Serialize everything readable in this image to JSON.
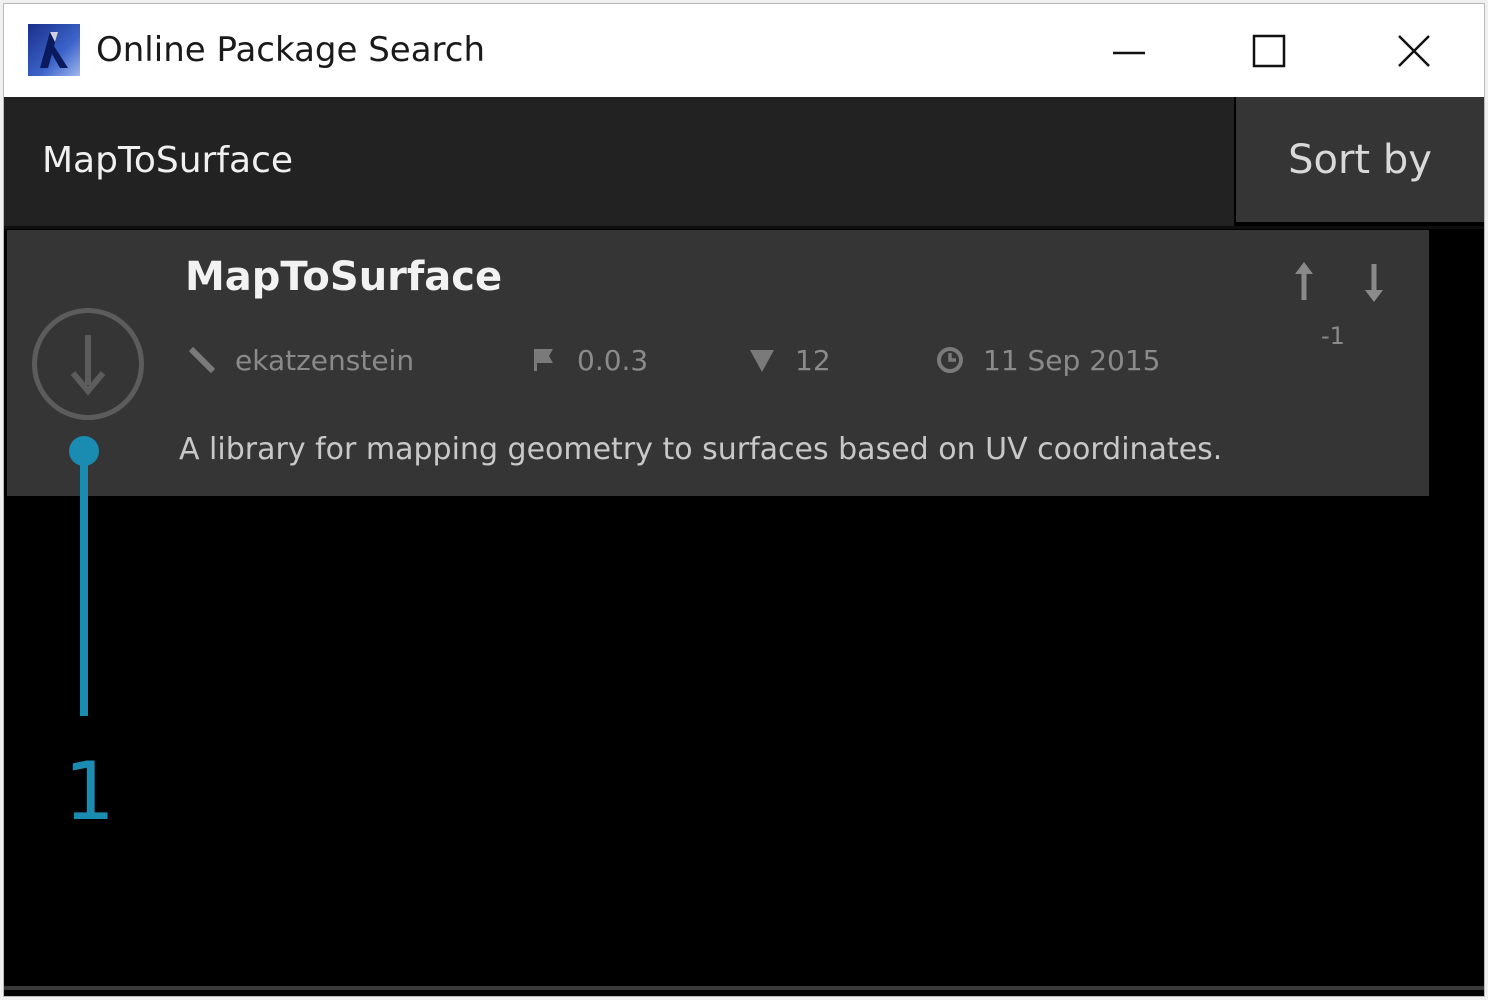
{
  "window": {
    "title": "Online Package Search",
    "icon": "dynamo-app-icon"
  },
  "search": {
    "query": "MapToSurface",
    "sort_label": "Sort by"
  },
  "package": {
    "name": "MapToSurface",
    "author": "ekatzenstein",
    "version": "0.0.3",
    "downloads": "12",
    "date": "11 Sep 2015",
    "votes": "-1",
    "description": "A library for mapping geometry to surfaces based on UV coordinates."
  },
  "callout": {
    "number": "1",
    "color": "#1a8cb2"
  }
}
